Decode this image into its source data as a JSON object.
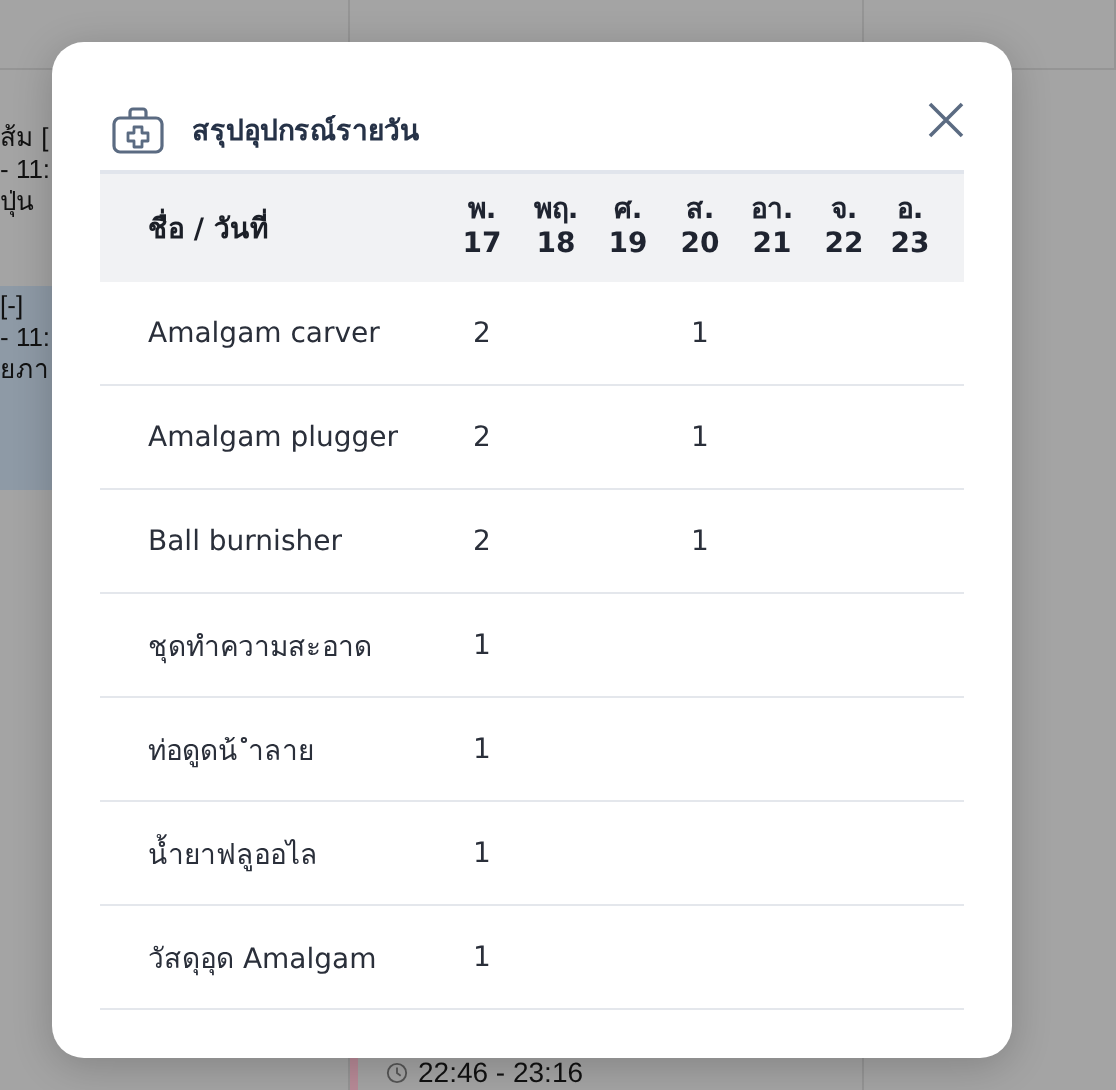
{
  "background": {
    "events": [
      {
        "lines": [
          "ส้ม [",
          "- 11:",
          "ปุ่น"
        ]
      },
      {
        "lines": [
          "[-]",
          "- 11:",
          "ยภา"
        ]
      }
    ],
    "bottom_event": {
      "time": "22:46 - 23:16"
    }
  },
  "dialog": {
    "title": "สรุปอุปกรณ์รายวัน",
    "name_header": "ชื่อ / วันที่",
    "days": [
      {
        "day": "พ.",
        "date": "17"
      },
      {
        "day": "พฤ.",
        "date": "18"
      },
      {
        "day": "ศ.",
        "date": "19"
      },
      {
        "day": "ส.",
        "date": "20"
      },
      {
        "day": "อา.",
        "date": "21"
      },
      {
        "day": "จ.",
        "date": "22"
      },
      {
        "day": "อ.",
        "date": "23"
      }
    ],
    "rows": [
      {
        "name": "Amalgam carver",
        "day_17": "2",
        "day_20": "1"
      },
      {
        "name": "Amalgam plugger",
        "day_17": "2",
        "day_20": "1"
      },
      {
        "name": "Ball burnisher",
        "day_17": "2",
        "day_20": "1"
      },
      {
        "name": "ชุดทำความสะอาด",
        "day_17": "1"
      },
      {
        "name": "ท่อดูดน้ ำลาย",
        "day_17": "1"
      },
      {
        "name": "น้ำยาฟลูออไล",
        "day_17": "1"
      },
      {
        "name": "วัสดุอุด Amalgam",
        "day_17": "1"
      }
    ]
  }
}
